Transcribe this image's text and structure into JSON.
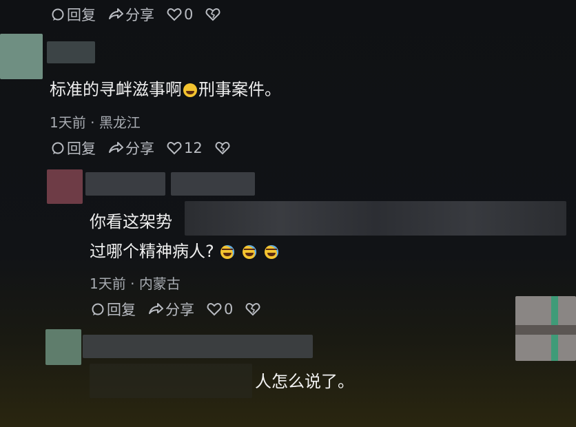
{
  "top_actions": {
    "reply": "回复",
    "share": "分享",
    "likes": "0"
  },
  "comment1": {
    "text_a": "标准的寻衅滋事啊",
    "text_b": "刑事案件。",
    "time": "1天前",
    "location": "黑龙江",
    "reply": "回复",
    "share": "分享",
    "likes": "12"
  },
  "comment2": {
    "text_line1": "你看这架势",
    "text_line2": "过哪个精神病人?",
    "time": "1天前",
    "location": "内蒙古",
    "reply": "回复",
    "share": "分享",
    "likes": "0"
  },
  "comment3": {
    "text": "人怎么说了。"
  },
  "colors": {
    "background": "#111316",
    "text": "#eeeeee",
    "muted": "#a7abb1"
  }
}
